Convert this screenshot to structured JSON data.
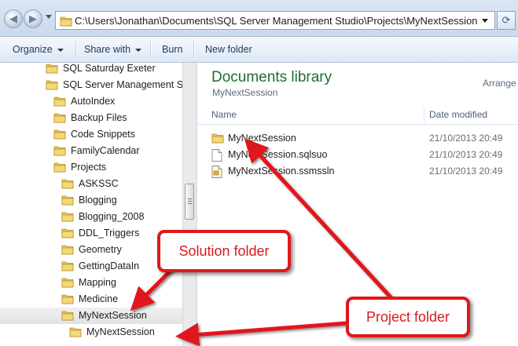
{
  "address_bar": {
    "path": "C:\\Users\\Jonathan\\Documents\\SQL Server Management Studio\\Projects\\MyNextSession",
    "back_icon": "back-arrow-icon",
    "forward_icon": "forward-arrow-icon",
    "refresh_icon": "refresh-icon"
  },
  "toolbar": {
    "items": [
      {
        "label": "Organize",
        "has_dropdown": true
      },
      {
        "label": "Share with",
        "has_dropdown": true
      },
      {
        "label": "Burn",
        "has_dropdown": false
      },
      {
        "label": "New folder",
        "has_dropdown": false
      }
    ]
  },
  "nav_tree": {
    "items": [
      {
        "label": "SQL Saturday Exeter",
        "depth": 0
      },
      {
        "label": "SQL Server Management Studio",
        "depth": 0
      },
      {
        "label": "AutoIndex",
        "depth": 1
      },
      {
        "label": "Backup Files",
        "depth": 1
      },
      {
        "label": "Code Snippets",
        "depth": 1
      },
      {
        "label": "FamilyCalendar",
        "depth": 1
      },
      {
        "label": "Projects",
        "depth": 1
      },
      {
        "label": "ASKSSC",
        "depth": 2
      },
      {
        "label": "Blogging",
        "depth": 2
      },
      {
        "label": "Blogging_2008",
        "depth": 2
      },
      {
        "label": "DDL_Triggers",
        "depth": 2
      },
      {
        "label": "Geometry",
        "depth": 2
      },
      {
        "label": "GettingDataIn",
        "depth": 2
      },
      {
        "label": "Mapping",
        "depth": 2
      },
      {
        "label": "Medicine",
        "depth": 2
      },
      {
        "label": "MyNextSession",
        "depth": 2,
        "selected": true
      },
      {
        "label": "MyNextSession",
        "depth": 3
      }
    ]
  },
  "library": {
    "title": "Documents library",
    "subtitle": "MyNextSession",
    "arrange_label": "Arrange"
  },
  "file_list": {
    "columns": {
      "name": "Name",
      "date": "Date modified"
    },
    "rows": [
      {
        "name": "MyNextSession",
        "date": "21/10/2013 20:49",
        "icon": "folder-icon"
      },
      {
        "name": "MyNextSession.sqlsuo",
        "date": "21/10/2013 20:49",
        "icon": "file-icon"
      },
      {
        "name": "MyNextSession.ssmssln",
        "date": "21/10/2013 20:49",
        "icon": "solution-file-icon"
      }
    ]
  },
  "annotations": {
    "solution_label": "Solution folder",
    "project_label": "Project folder",
    "color": "#e0181a"
  }
}
